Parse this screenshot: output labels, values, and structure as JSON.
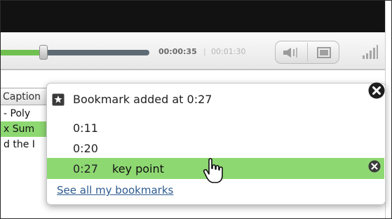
{
  "player": {
    "progress_fraction": 0.29,
    "time_current": "00:00:35",
    "time_separator": "|",
    "time_total": "00:01:30"
  },
  "controls": {
    "volume_icon": "speaker-icon",
    "fullscreen_icon": "screen-icon",
    "signal_icon": "signal-bars-icon"
  },
  "transcript": {
    "tab_label": "Caption",
    "lines": [
      {
        "text": "- Poly",
        "highlighted": false
      },
      {
        "text": "x Sum",
        "highlighted": true
      },
      {
        "text": "d the I",
        "highlighted": false
      }
    ]
  },
  "bookmark_popup": {
    "title": "Bookmark added at 0:27",
    "bookmarks": [
      {
        "time": "0:11",
        "note": ""
      },
      {
        "time": "0:20",
        "note": ""
      },
      {
        "time": "0:27",
        "note": "key point",
        "active": true
      }
    ],
    "see_all_label": "See all my bookmarks"
  },
  "colors": {
    "progress_played": "#6fc04f",
    "progress_track": "#5e6a74",
    "highlight": "#8ed872",
    "link": "#2d5b8f"
  }
}
